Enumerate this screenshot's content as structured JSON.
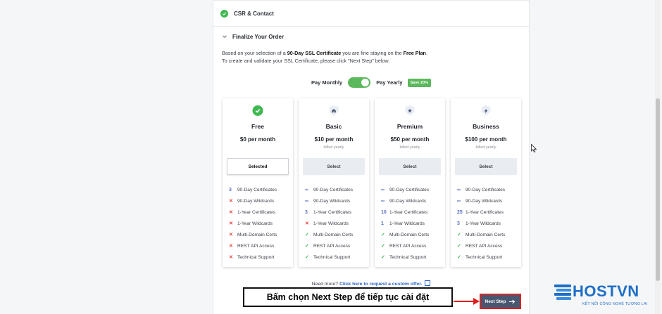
{
  "steps": {
    "done_label": "CSR & Contact",
    "current_label": "Finalize Your Order"
  },
  "description": {
    "line1_a": "Based on your selection of a ",
    "line1_b": "90-Day SSL Certificate",
    "line1_c": " you are fine staying on the ",
    "line1_d": "Free Plan",
    "line1_e": ".",
    "line2": "To create and validate your SSL Certificate, please click \"Next Step\" below."
  },
  "billing": {
    "monthly_label": "Pay Monthly",
    "yearly_label": "Pay Yearly",
    "save_badge": "Save 20%",
    "toggle_state": "yearly"
  },
  "plans": [
    {
      "name": "Free",
      "price": "$0 per month",
      "billed": "",
      "button": "Selected",
      "selected": true,
      "icon": "check-circle-icon",
      "features": [
        {
          "mark": "3",
          "type": "num",
          "label": "90-Day Certificates"
        },
        {
          "mark": "✕",
          "type": "x",
          "label": "90-Day Wildcards"
        },
        {
          "mark": "✕",
          "type": "x",
          "label": "1-Year Certificates"
        },
        {
          "mark": "✕",
          "type": "x",
          "label": "1-Year Wildcards"
        },
        {
          "mark": "✕",
          "type": "x",
          "label": "Multi-Domain Certs"
        },
        {
          "mark": "✕",
          "type": "x",
          "label": "REST API Access"
        },
        {
          "mark": "✕",
          "type": "x",
          "label": "Technical Support"
        }
      ]
    },
    {
      "name": "Basic",
      "price": "$10 per month",
      "billed": "billed yearly",
      "button": "Select",
      "selected": false,
      "icon": "home-icon",
      "features": [
        {
          "mark": "∞",
          "type": "num",
          "label": "90-Day Certificates"
        },
        {
          "mark": "∞",
          "type": "num",
          "label": "90-Day Wildcards"
        },
        {
          "mark": "3",
          "type": "num",
          "label": "1-Year Certificates"
        },
        {
          "mark": "✕",
          "type": "x",
          "label": "1-Year Wildcards"
        },
        {
          "mark": "✓",
          "type": "ok",
          "label": "Multi-Domain Certs"
        },
        {
          "mark": "✓",
          "type": "ok",
          "label": "REST API Access"
        },
        {
          "mark": "✓",
          "type": "ok",
          "label": "Technical Support"
        }
      ]
    },
    {
      "name": "Premium",
      "price": "$50 per month",
      "billed": "billed yearly",
      "button": "Select",
      "selected": false,
      "icon": "star-icon",
      "features": [
        {
          "mark": "∞",
          "type": "num",
          "label": "90-Day Certificates"
        },
        {
          "mark": "∞",
          "type": "num",
          "label": "90-Day Wildcards"
        },
        {
          "mark": "10",
          "type": "num",
          "label": "1-Year Certificates"
        },
        {
          "mark": "1",
          "type": "num",
          "label": "1-Year Wildcards"
        },
        {
          "mark": "✓",
          "type": "ok",
          "label": "Multi-Domain Certs"
        },
        {
          "mark": "✓",
          "type": "ok",
          "label": "REST API Access"
        },
        {
          "mark": "✓",
          "type": "ok",
          "label": "Technical Support"
        }
      ]
    },
    {
      "name": "Business",
      "price": "$100 per month",
      "billed": "billed yearly",
      "button": "Select",
      "selected": false,
      "icon": "lightning-icon",
      "features": [
        {
          "mark": "∞",
          "type": "num",
          "label": "90-Day Certificates"
        },
        {
          "mark": "∞",
          "type": "num",
          "label": "90-Day Wildcards"
        },
        {
          "mark": "25",
          "type": "num",
          "label": "1-Year Certificates"
        },
        {
          "mark": "3",
          "type": "num",
          "label": "1-Year Wildcards"
        },
        {
          "mark": "✓",
          "type": "ok",
          "label": "Multi-Domain Certs"
        },
        {
          "mark": "✓",
          "type": "ok",
          "label": "REST API Access"
        },
        {
          "mark": "✓",
          "type": "ok",
          "label": "Technical Support"
        }
      ]
    }
  ],
  "more": {
    "question": "Need more?",
    "link": "Click here to request a custom offer."
  },
  "next_button": "Next Step",
  "callout": "Bấm chọn Next Step để tiếp tục cài đặt",
  "logo": {
    "brand": "HOSTVN",
    "tagline": "KẾT NỐI CÔNG NGHỆ TƯƠNG LAI"
  },
  "colors": {
    "accent_green": "#5cb85c",
    "check_green": "#3fb950",
    "cross_red": "#e0403a",
    "next_button_bg": "#4a5770",
    "highlight_red": "#e02020",
    "logo_blue": "#1f6fc7"
  }
}
